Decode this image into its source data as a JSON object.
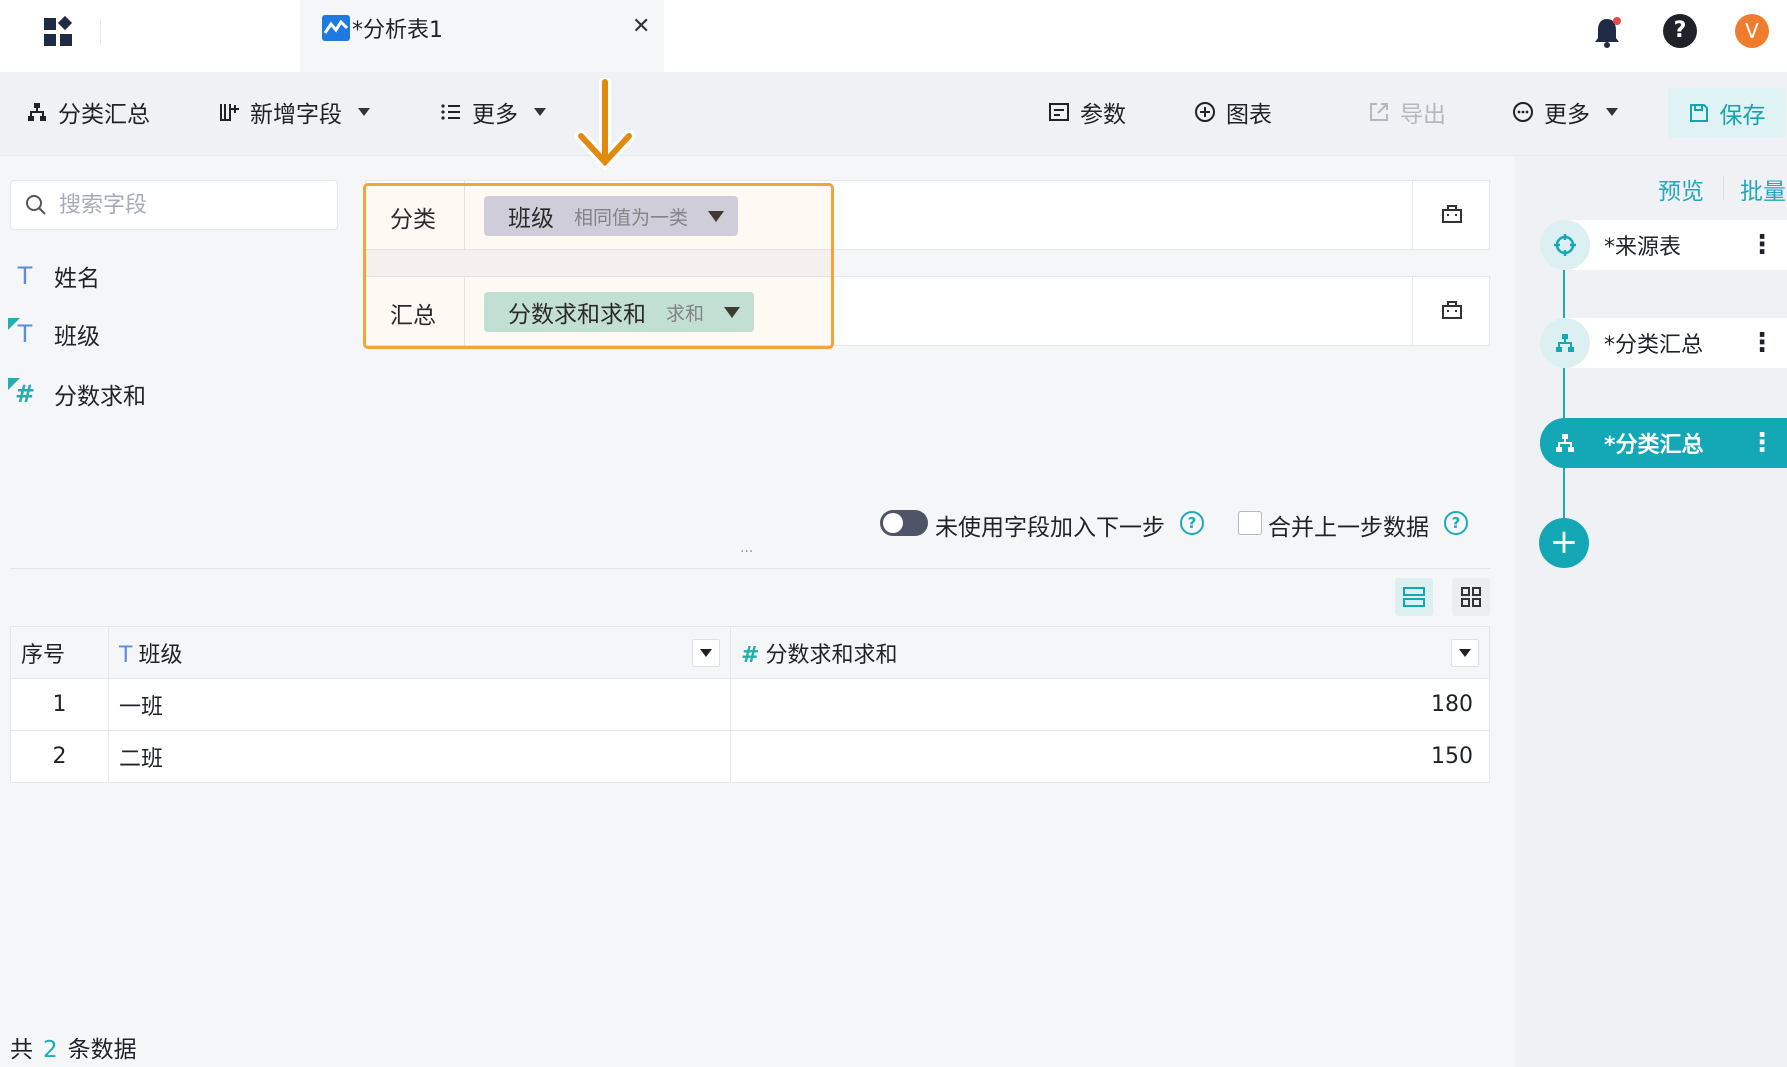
{
  "tab": {
    "title": "*分析表1"
  },
  "toolbar": {
    "group_summary": "分类汇总",
    "add_field": "新增字段",
    "more_left": "更多",
    "params": "参数",
    "chart": "图表",
    "export": "导出",
    "more_right": "更多",
    "save": "保存"
  },
  "search": {
    "placeholder": "搜索字段"
  },
  "fields": [
    {
      "name": "姓名",
      "type": "T"
    },
    {
      "name": "班级",
      "type": "T"
    },
    {
      "name": "分数求和",
      "type": "#"
    }
  ],
  "config": {
    "category_label": "分类",
    "category_chip": {
      "name": "班级",
      "mode": "相同值为一类"
    },
    "summary_label": "汇总",
    "summary_chip": {
      "name": "分数求和求和",
      "mode": "求和"
    }
  },
  "options": {
    "unused_fields": "未使用字段加入下一步",
    "merge_prev": "合并上一步数据"
  },
  "table": {
    "headers": [
      "序号",
      "班级",
      "分数求和求和"
    ],
    "rows": [
      {
        "idx": "1",
        "class": "一班",
        "sum": "180"
      },
      {
        "idx": "2",
        "class": "二班",
        "sum": "150"
      }
    ]
  },
  "footer": {
    "prefix": "共",
    "count": "2",
    "suffix": "条数据"
  },
  "rightpanel": {
    "preview": "预览",
    "batch": "批量",
    "steps": [
      {
        "label": "*来源表",
        "icon": "crosshair-icon"
      },
      {
        "label": "*分类汇总",
        "icon": "hierarchy-icon"
      },
      {
        "label": "*分类汇总",
        "icon": "hierarchy-icon",
        "active": true
      }
    ],
    "add": "+"
  },
  "avatar": {
    "letter": "V"
  },
  "colors": {
    "accent": "#14a8b6",
    "highlight": "#f2a33a",
    "avatar": "#f07d2e"
  }
}
